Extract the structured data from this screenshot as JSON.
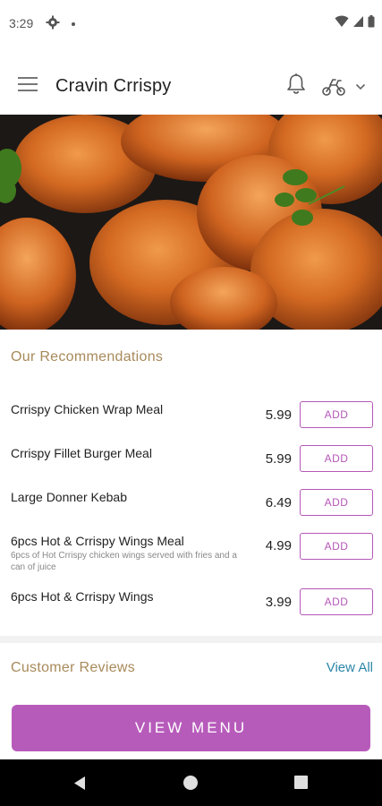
{
  "status": {
    "time": "3:29"
  },
  "app": {
    "title": "Cravin Crrispy"
  },
  "recommendations": {
    "title": "Our Recommendations",
    "add_label": "ADD",
    "items": [
      {
        "name": "Crrispy Chicken Wrap Meal",
        "price": "5.99",
        "description": ""
      },
      {
        "name": "Crrispy Fillet Burger Meal",
        "price": "5.99",
        "description": ""
      },
      {
        "name": "Large Donner Kebab",
        "price": "6.49",
        "description": ""
      },
      {
        "name": "6pcs Hot & Crrispy Wings Meal",
        "price": "4.99",
        "description": "6pcs of Hot Crrispy chicken wings served with fries and a can of juice"
      },
      {
        "name": "6pcs Hot & Crrispy Wings",
        "price": "3.99",
        "description": ""
      }
    ]
  },
  "reviews": {
    "title": "Customer Reviews",
    "view_all": "View All"
  },
  "view_menu_label": "VIEW MENU",
  "colors": {
    "accent": "#b75bbb",
    "section_title": "#a88a5a",
    "link": "#2b86a8"
  },
  "icons": [
    "gear-icon",
    "wifi-icon",
    "signal-icon",
    "battery-icon",
    "menu-icon",
    "bell-icon",
    "scooter-icon",
    "chevron-down-icon",
    "back-icon",
    "home-icon",
    "recents-icon"
  ]
}
